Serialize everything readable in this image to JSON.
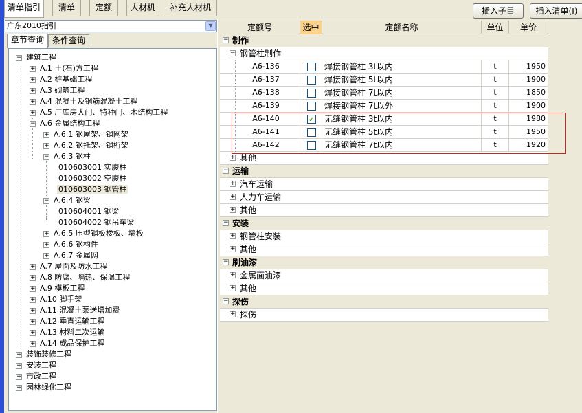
{
  "tabs": [
    "清单指引",
    "清单",
    "定额",
    "人材机",
    "补充人材机"
  ],
  "buttons": {
    "insert_child": "插入子目",
    "insert_list": "插入清单(I)"
  },
  "combo": {
    "value": "广东2010指引"
  },
  "left_tabs": [
    "章节查询",
    "条件查询"
  ],
  "tree": [
    {
      "label": "建筑工程",
      "pm": "−"
    },
    {
      "label": "A.1 土(石)方工程",
      "pm": "+"
    },
    {
      "label": "A.2 桩基础工程",
      "pm": "+"
    },
    {
      "label": "A.3 砌筑工程",
      "pm": "+"
    },
    {
      "label": "A.4 混凝土及钢筋混凝土工程",
      "pm": "+"
    },
    {
      "label": "A.5 厂库房大门、特种门、木结构工程",
      "pm": "+"
    },
    {
      "label": "A.6 金属结构工程",
      "pm": "−"
    },
    {
      "label": "A.6.1 钢屋架、钢网架",
      "pm": "+"
    },
    {
      "label": "A.6.2 钢托架、钢桁架",
      "pm": "+"
    },
    {
      "label": "A.6.3 钢柱",
      "pm": "−"
    },
    {
      "label": "010603001  实腹柱",
      "pm": ""
    },
    {
      "label": "010603002  空腹柱",
      "pm": ""
    },
    {
      "label": "010603003  钢管柱",
      "pm": ""
    },
    {
      "label": "A.6.4 钢梁",
      "pm": "−"
    },
    {
      "label": "010604001  钢梁",
      "pm": ""
    },
    {
      "label": "010604002  钢吊车梁",
      "pm": ""
    },
    {
      "label": "A.6.5 压型钢板楼板、墙板",
      "pm": "+"
    },
    {
      "label": "A.6.6 钢构件",
      "pm": "+"
    },
    {
      "label": "A.6.7 金属网",
      "pm": "+"
    },
    {
      "label": "A.7 屋面及防水工程",
      "pm": "+"
    },
    {
      "label": "A.8 防腐、隔热、保温工程",
      "pm": "+"
    },
    {
      "label": "A.9 模板工程",
      "pm": "+"
    },
    {
      "label": "A.10 脚手架",
      "pm": "+"
    },
    {
      "label": "A.11 混凝土泵送增加费",
      "pm": "+"
    },
    {
      "label": "A.12 垂直运输工程",
      "pm": "+"
    },
    {
      "label": "A.13 材料二次运输",
      "pm": "+"
    },
    {
      "label": "A.14 成品保护工程",
      "pm": "+"
    },
    {
      "label": "装饰装修工程",
      "pm": "+"
    },
    {
      "label": "安装工程",
      "pm": "+"
    },
    {
      "label": "市政工程",
      "pm": "+"
    },
    {
      "label": "园林绿化工程",
      "pm": "+"
    }
  ],
  "grid": {
    "headers": [
      "定额号",
      "选中",
      "定额名称",
      "单位",
      "单价"
    ],
    "rows": [
      {
        "type": "group",
        "name": "制作",
        "pm": "−"
      },
      {
        "type": "sub",
        "name": "钢管柱制作",
        "pm": "−"
      },
      {
        "type": "item",
        "code": "A6-136",
        "checked": false,
        "name": "焊接钢管柱 3t以内",
        "unit": "t",
        "price": "1950"
      },
      {
        "type": "item",
        "code": "A6-137",
        "checked": false,
        "name": "焊接钢管柱 5t以内",
        "unit": "t",
        "price": "1900"
      },
      {
        "type": "item",
        "code": "A6-138",
        "checked": false,
        "name": "焊接钢管柱 7t以内",
        "unit": "t",
        "price": "1850"
      },
      {
        "type": "item",
        "code": "A6-139",
        "checked": false,
        "name": "焊接钢管柱 7t以外",
        "unit": "t",
        "price": "1900"
      },
      {
        "type": "item",
        "code": "A6-140",
        "checked": true,
        "name": "无缝钢管柱 3t以内",
        "unit": "t",
        "price": "1980"
      },
      {
        "type": "item",
        "code": "A6-141",
        "checked": false,
        "name": "无缝钢管柱 5t以内",
        "unit": "t",
        "price": "1950"
      },
      {
        "type": "item",
        "code": "A6-142",
        "checked": false,
        "name": "无缝钢管柱 7t以内",
        "unit": "t",
        "price": "1920"
      },
      {
        "type": "sub",
        "name": "其他",
        "pm": "+"
      },
      {
        "type": "group",
        "name": "运输",
        "pm": "−"
      },
      {
        "type": "sub",
        "name": "汽车运输",
        "pm": "+"
      },
      {
        "type": "sub",
        "name": "人力车运输",
        "pm": "+"
      },
      {
        "type": "sub",
        "name": "其他",
        "pm": "+"
      },
      {
        "type": "group",
        "name": "安装",
        "pm": "−"
      },
      {
        "type": "sub",
        "name": "钢管柱安装",
        "pm": "+"
      },
      {
        "type": "sub",
        "name": "其他",
        "pm": "+"
      },
      {
        "type": "group",
        "name": "刷油漆",
        "pm": "−"
      },
      {
        "type": "sub",
        "name": "金属面油漆",
        "pm": "+"
      },
      {
        "type": "sub",
        "name": "其他",
        "pm": "+"
      },
      {
        "type": "group",
        "name": "探伤",
        "pm": "−"
      },
      {
        "type": "sub",
        "name": "探伤",
        "pm": "+"
      }
    ]
  }
}
